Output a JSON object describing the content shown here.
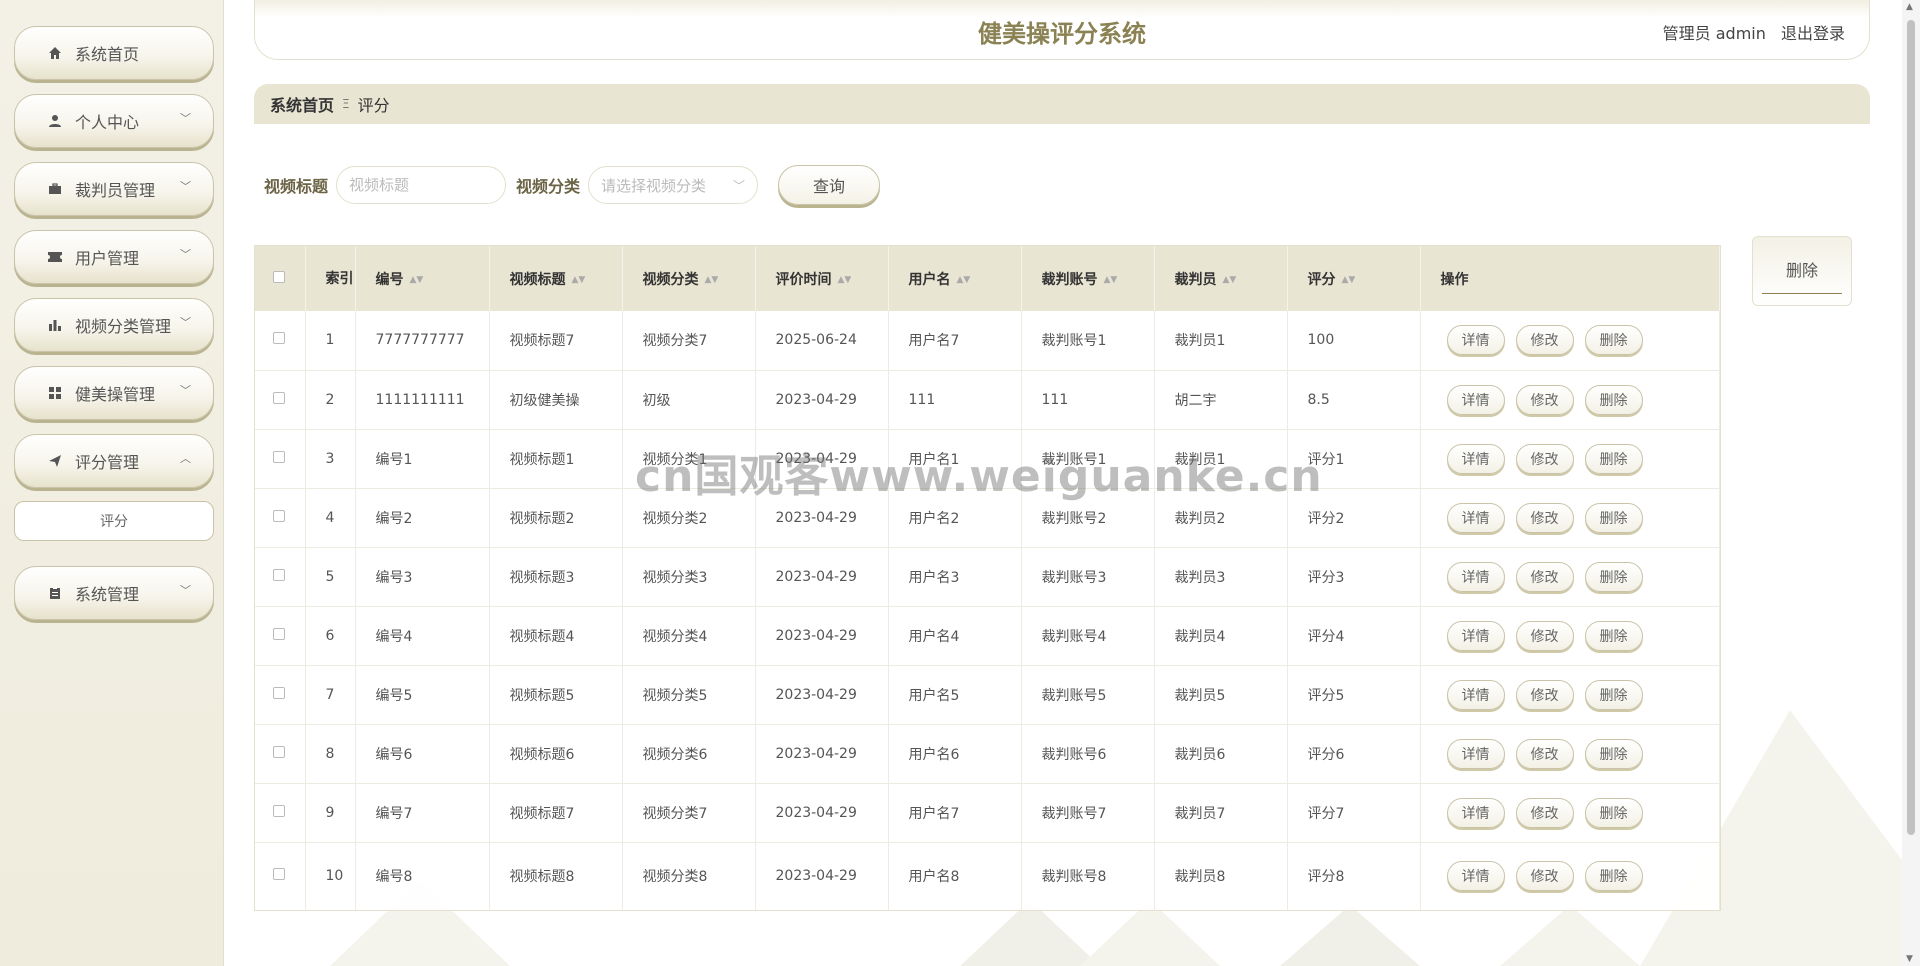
{
  "app": {
    "title": "健美操评分系统"
  },
  "header": {
    "user_label": "管理员 admin",
    "logout_label": "退出登录"
  },
  "sidebar": {
    "items": [
      {
        "label": "系统首页",
        "icon": "home-icon",
        "has_arrow": false
      },
      {
        "label": "个人中心",
        "icon": "user-icon",
        "has_arrow": true
      },
      {
        "label": "裁判员管理",
        "icon": "briefcase-icon",
        "has_arrow": true
      },
      {
        "label": "用户管理",
        "icon": "ticket-icon",
        "has_arrow": true
      },
      {
        "label": "视频分类管理",
        "icon": "bar-chart-icon",
        "has_arrow": true
      },
      {
        "label": "健美操管理",
        "icon": "grid-icon",
        "has_arrow": true
      },
      {
        "label": "评分管理",
        "icon": "send-icon",
        "has_arrow": true,
        "expanded": true
      },
      {
        "label": "系统管理",
        "icon": "clipboard-icon",
        "has_arrow": true
      }
    ],
    "submenu": {
      "label": "评分"
    }
  },
  "breadcrumb": {
    "home": "系统首页",
    "separator": "Ξ",
    "current": "评分"
  },
  "search": {
    "title_label": "视频标题",
    "title_placeholder": "视频标题",
    "category_label": "视频分类",
    "category_placeholder": "请选择视频分类",
    "query_label": "查询"
  },
  "actions": {
    "delete_label": "删除"
  },
  "table": {
    "headers": [
      "索引",
      "编号",
      "视频标题",
      "视频分类",
      "评价时间",
      "用户名",
      "裁判账号",
      "裁判员",
      "评分",
      "操作"
    ],
    "op_labels": {
      "detail": "详情",
      "edit": "修改",
      "delete": "删除"
    },
    "rows": [
      [
        "1",
        "7777777777",
        "视频标题7",
        "视频分类7",
        "2025-06-24",
        "用户名7",
        "裁判账号1",
        "裁判员1",
        "100"
      ],
      [
        "2",
        "1111111111",
        "初级健美操",
        "初级",
        "2023-04-29",
        "111",
        "111",
        "胡二宇",
        "8.5"
      ],
      [
        "3",
        "编号1",
        "视频标题1",
        "视频分类1",
        "2023-04-29",
        "用户名1",
        "裁判账号1",
        "裁判员1",
        "评分1"
      ],
      [
        "4",
        "编号2",
        "视频标题2",
        "视频分类2",
        "2023-04-29",
        "用户名2",
        "裁判账号2",
        "裁判员2",
        "评分2"
      ],
      [
        "5",
        "编号3",
        "视频标题3",
        "视频分类3",
        "2023-04-29",
        "用户名3",
        "裁判账号3",
        "裁判员3",
        "评分3"
      ],
      [
        "6",
        "编号4",
        "视频标题4",
        "视频分类4",
        "2023-04-29",
        "用户名4",
        "裁判账号4",
        "裁判员4",
        "评分4"
      ],
      [
        "7",
        "编号5",
        "视频标题5",
        "视频分类5",
        "2023-04-29",
        "用户名5",
        "裁判账号5",
        "裁判员5",
        "评分5"
      ],
      [
        "8",
        "编号6",
        "视频标题6",
        "视频分类6",
        "2023-04-29",
        "用户名6",
        "裁判账号6",
        "裁判员6",
        "评分6"
      ],
      [
        "9",
        "编号7",
        "视频标题7",
        "视频分类7",
        "2023-04-29",
        "用户名7",
        "裁判账号7",
        "裁判员7",
        "评分7"
      ],
      [
        "10",
        "编号8",
        "视频标题8",
        "视频分类8",
        "2023-04-29",
        "用户名8",
        "裁判账号8",
        "裁判员8",
        "评分8"
      ]
    ]
  },
  "watermark": "cn国观客www.weiguanke.cn",
  "colors": {
    "accent": "#8a8253",
    "sidebar_bg": "#f3f1e6",
    "header_row": "#e8e5d3"
  }
}
